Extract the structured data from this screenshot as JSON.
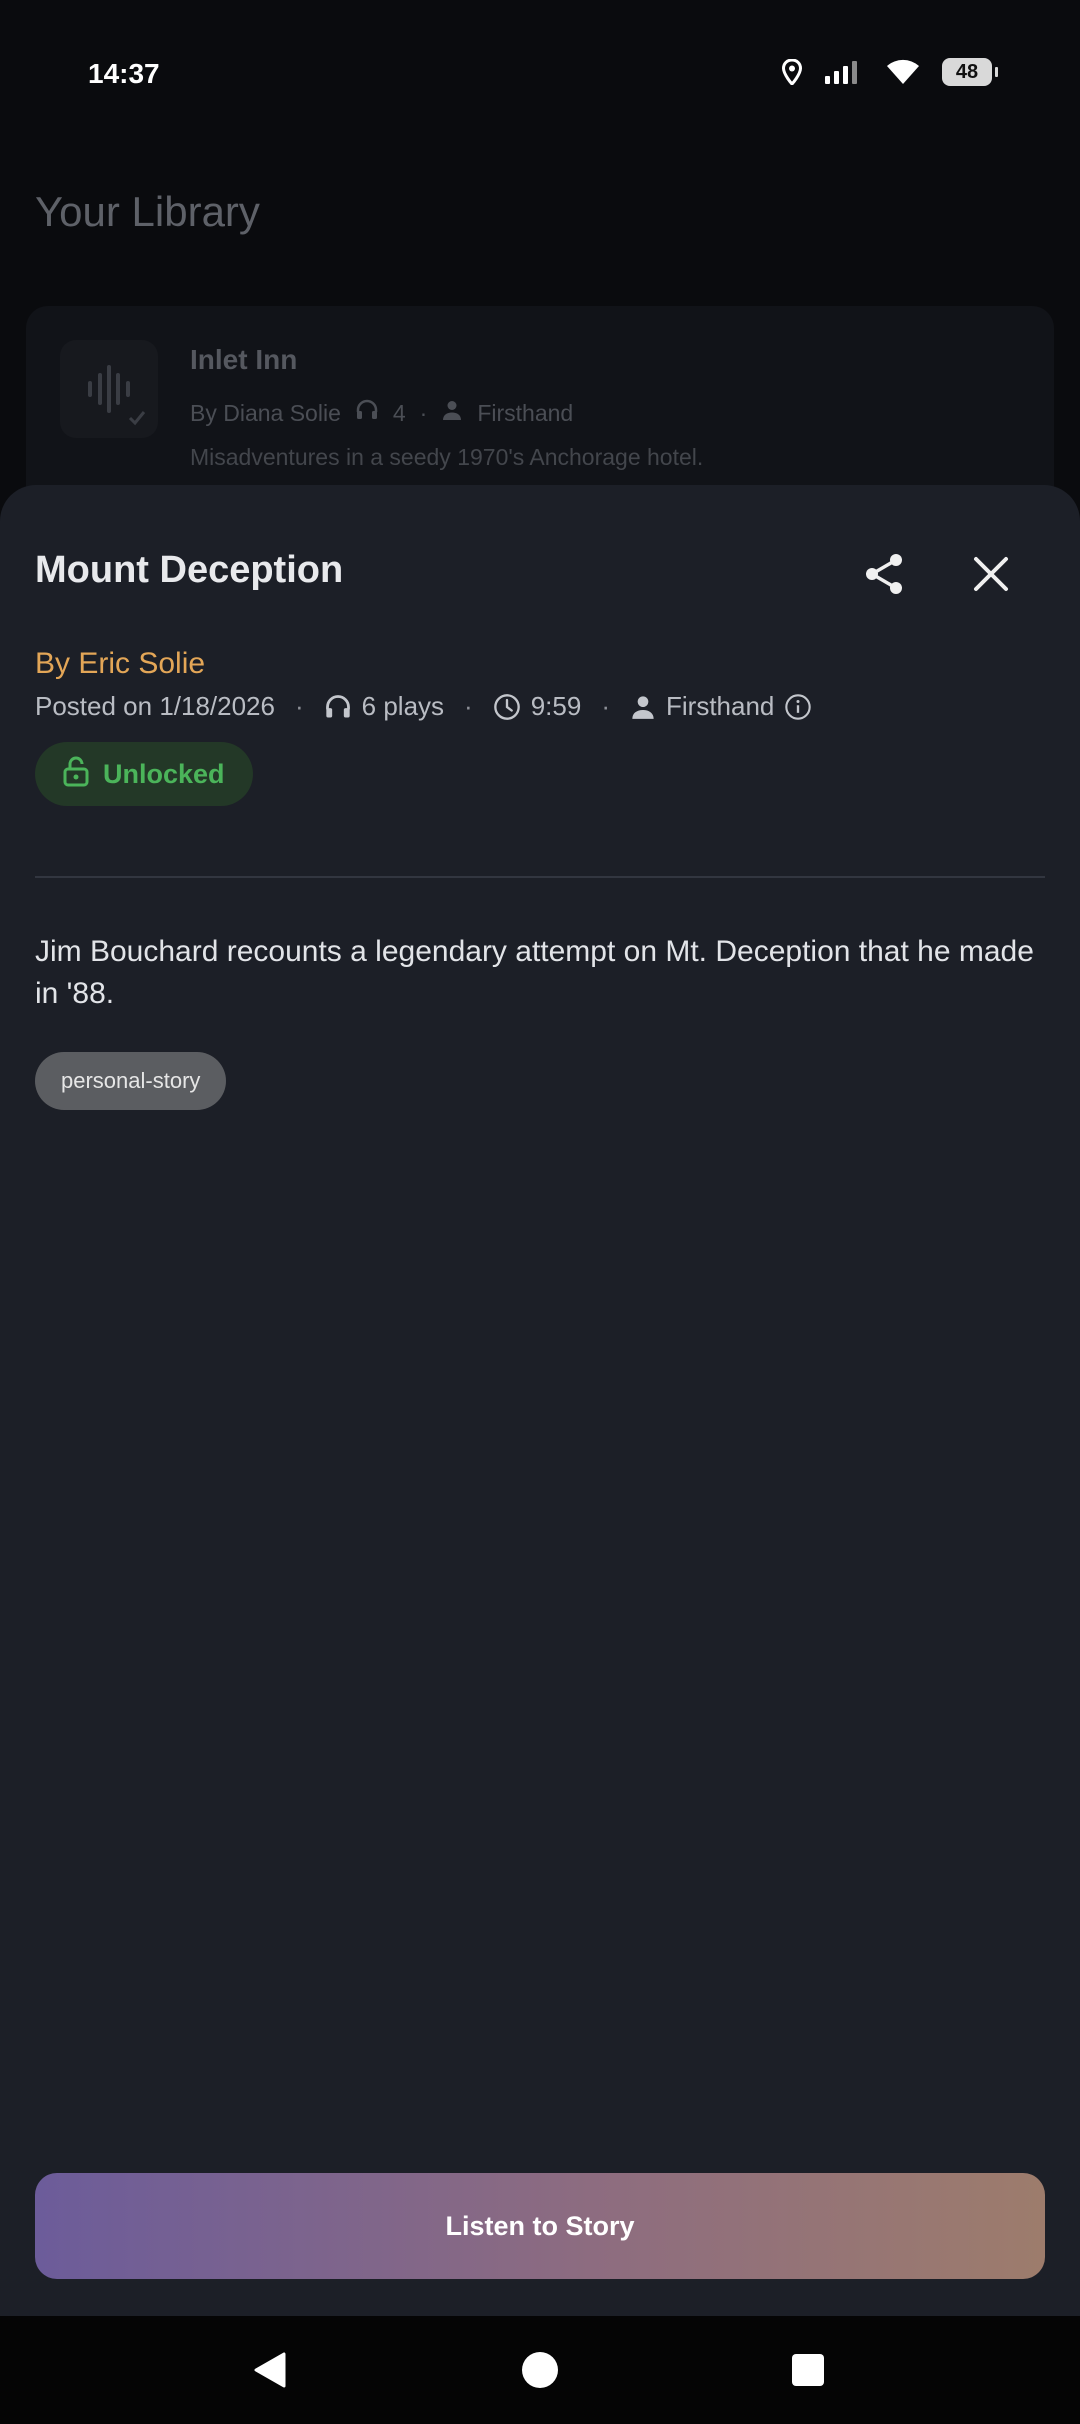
{
  "status_bar": {
    "time": "14:37",
    "battery": "48"
  },
  "library": {
    "title": "Your Library",
    "card": {
      "title": "Inlet Inn",
      "author": "By Diana Solie",
      "plays": "4",
      "type": "Firsthand",
      "description": "Misadventures in a seedy 1970's Anchorage hotel."
    }
  },
  "sheet": {
    "title": "Mount Deception",
    "author": "By Eric Solie",
    "posted": "Posted on 1/18/2026",
    "plays": "6 plays",
    "duration": "9:59",
    "type": "Firsthand",
    "badge": "Unlocked",
    "description": "Jim Bouchard recounts a legendary attempt on Mt. Deception that he made in '88.",
    "tag": "personal-story",
    "listen_button": "Listen to Story"
  },
  "colors": {
    "background": "#0a0b0e",
    "sheet": "#1c1f27",
    "author_accent": "#e3a657",
    "unlocked_green": "#4bb45a",
    "button_gradient_start": "#6c5c9a",
    "button_gradient_end": "#9d7c6c"
  },
  "icons": [
    "location-icon",
    "signal-icon",
    "wifi-icon",
    "battery-icon",
    "waveform-icon",
    "headphones-icon",
    "person-icon",
    "share-icon",
    "close-icon",
    "clock-icon",
    "info-icon",
    "lock-open-icon",
    "back-icon",
    "home-icon",
    "recents-icon"
  ]
}
